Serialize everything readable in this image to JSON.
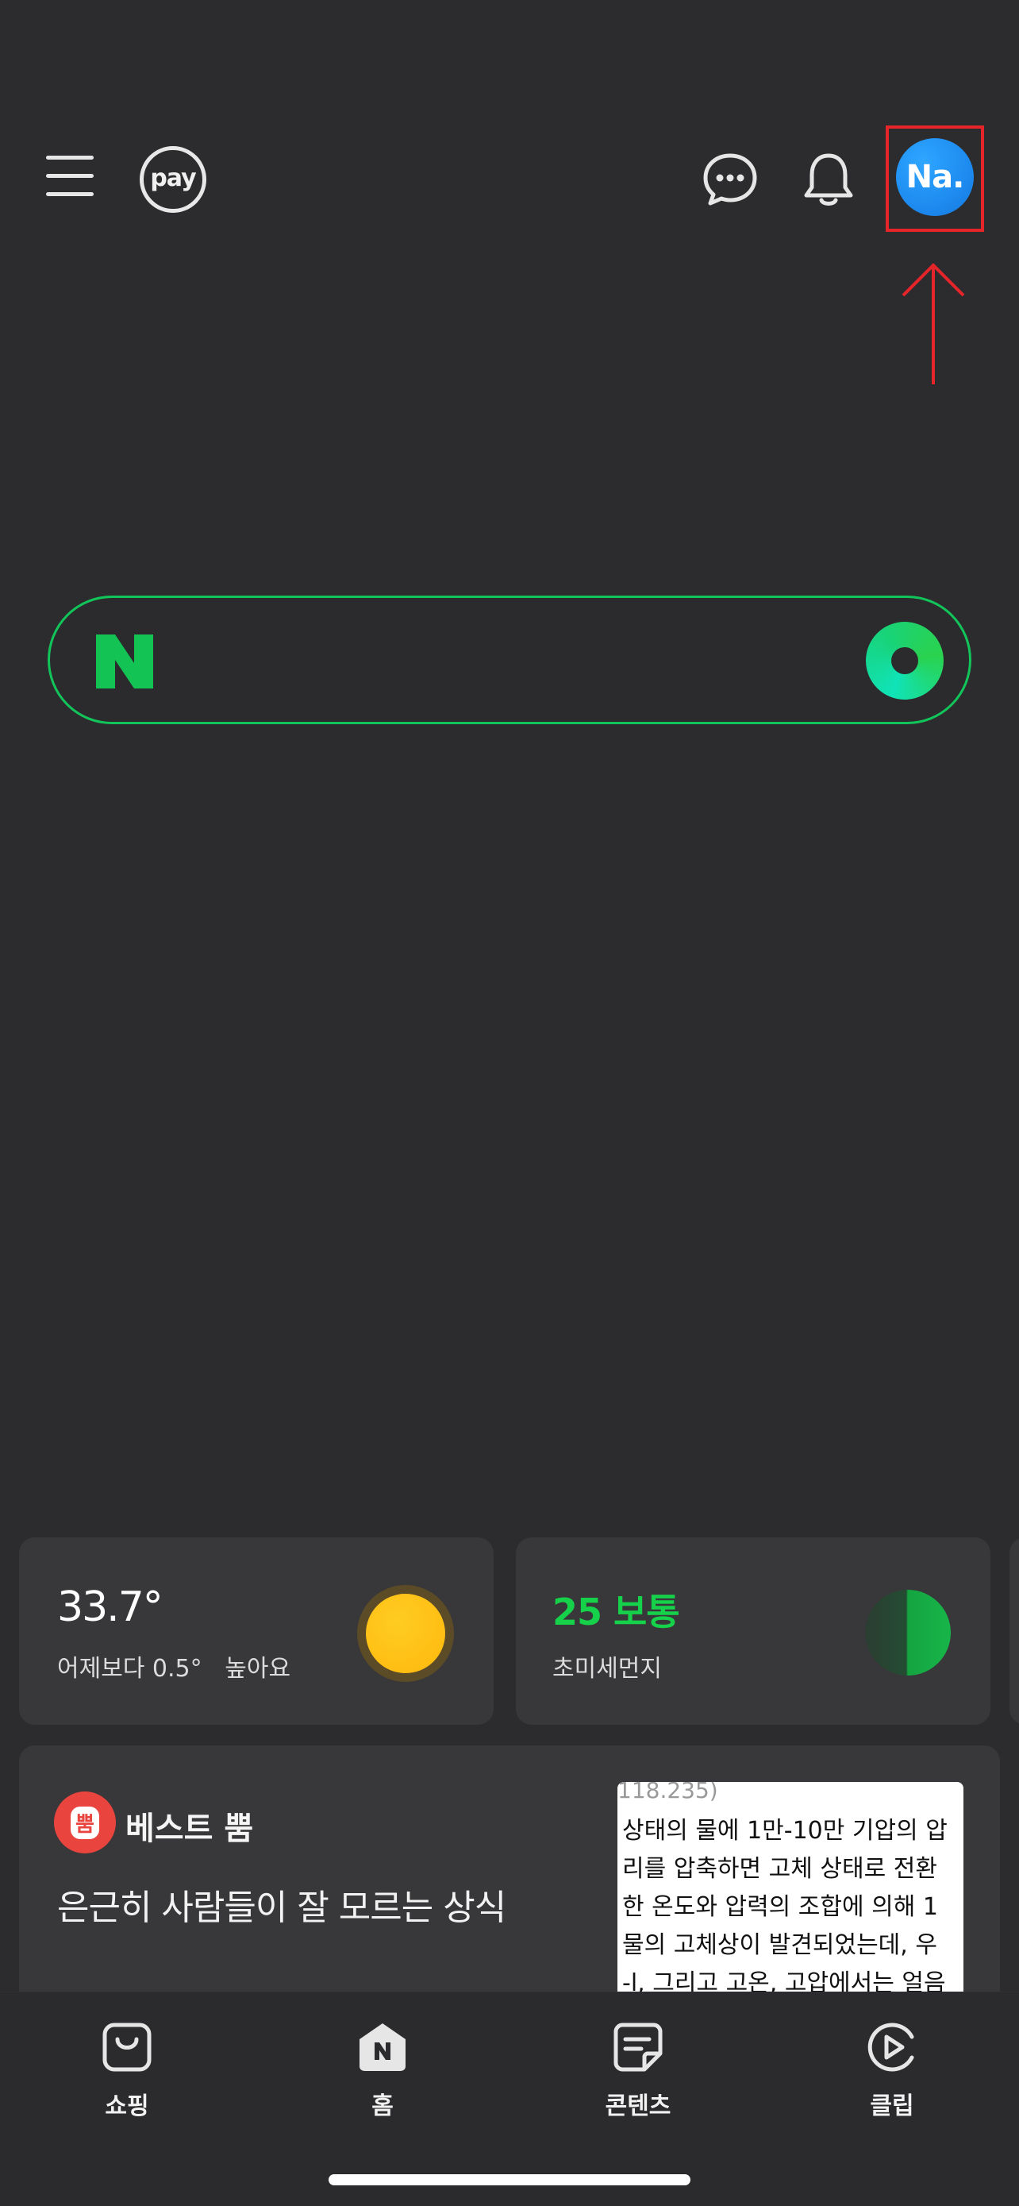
{
  "topbar": {
    "menu_icon": "hamburger-menu-icon",
    "pay_label": "pay",
    "chat_icon": "chat-bubble-icon",
    "bell_icon": "bell-icon",
    "avatar_text": "Na."
  },
  "annotation": {
    "highlight_color": "#e5252a"
  },
  "search": {
    "logo": "N",
    "accent": "#12c55a"
  },
  "weather": {
    "temperature": "33.7°",
    "comparison": "어제보다 0.5°   높아요"
  },
  "air_quality": {
    "value": "25 보통",
    "label": "초미세먼지",
    "status_color": "#16d14a"
  },
  "news": {
    "badge": "뿜",
    "tag": "베스트 뿜",
    "title": "은근히 사람들이 잘 모르는 상식",
    "thumbnail_lines": [
      "118.235)",
      "상태의 물에 1만-10만 기압의 압",
      "리를 압축하면 고체 상태로 전환",
      "한 온도와 압력의 조합에 의해 1",
      "물의 고체상이 발견되었는데, 우",
      "-l, 그리고 고온, 고압에서는 얼음"
    ]
  },
  "bottom_nav": {
    "items": [
      {
        "label": "쇼핑",
        "icon": "shopping-bag-icon"
      },
      {
        "label": "홈",
        "icon": "home-n-icon"
      },
      {
        "label": "콘텐츠",
        "icon": "content-note-icon"
      },
      {
        "label": "클립",
        "icon": "clip-play-icon"
      }
    ]
  }
}
